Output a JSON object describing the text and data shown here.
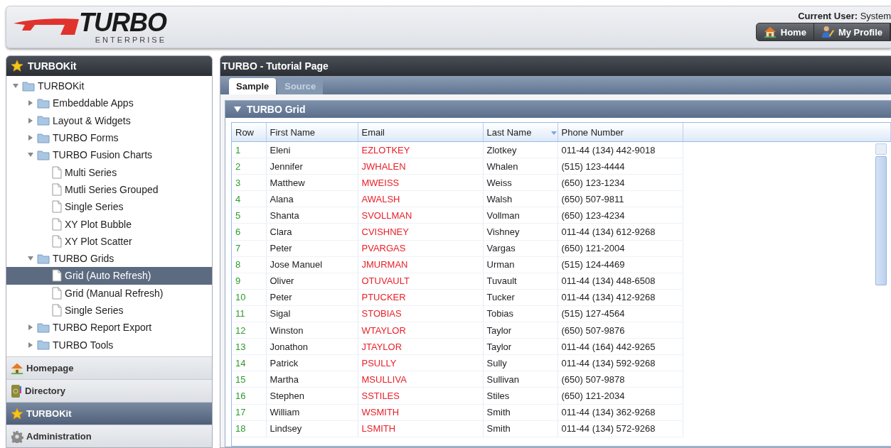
{
  "header": {
    "logo": {
      "title": "TURBO",
      "subtitle": "ENTERPRISE"
    },
    "current_user": "**Current User:** System",
    "buttons": [
      {
        "label": "Home",
        "kind": "home"
      },
      {
        "label": "My Profile",
        "kind": "profile"
      }
    ]
  },
  "sidebar": {
    "title": "TURBOKit",
    "tree": [
      {
        "label": "TURBOKit",
        "kind": "folder",
        "expanded": true,
        "selected": false,
        "children": [
          {
            "label": "Embeddable Apps",
            "kind": "folder",
            "expanded": false,
            "selected": false
          },
          {
            "label": "Layout & Widgets",
            "kind": "folder",
            "expanded": false,
            "selected": false
          },
          {
            "label": "TURBO Forms",
            "kind": "folder",
            "expanded": false,
            "selected": false
          },
          {
            "label": "TURBO Fusion Charts",
            "kind": "folder",
            "expanded": true,
            "selected": false,
            "children": [
              {
                "label": "Multi Series",
                "kind": "page",
                "selected": false
              },
              {
                "label": "Mutli Series Grouped",
                "kind": "page",
                "selected": false
              },
              {
                "label": "Single Series",
                "kind": "page",
                "selected": false
              },
              {
                "label": "XY Plot Bubble",
                "kind": "page",
                "selected": false
              },
              {
                "label": "XY Plot Scatter",
                "kind": "page",
                "selected": false
              }
            ]
          },
          {
            "label": "TURBO Grids",
            "kind": "folder",
            "expanded": true,
            "selected": false,
            "children": [
              {
                "label": "Grid (Auto Refresh)",
                "kind": "page",
                "selected": true
              },
              {
                "label": "Grid (Manual Refresh)",
                "kind": "page",
                "selected": false
              },
              {
                "label": "Single Series",
                "kind": "page",
                "selected": false
              }
            ]
          },
          {
            "label": "TURBO Report Export",
            "kind": "folder",
            "expanded": false,
            "selected": false
          },
          {
            "label": "TURBO Tools",
            "kind": "folder",
            "expanded": false,
            "selected": false
          }
        ]
      }
    ],
    "nav": [
      {
        "label": "Homepage",
        "kind": "home",
        "selected": false
      },
      {
        "label": "Directory",
        "kind": "book",
        "selected": false
      },
      {
        "label": "TURBOKit",
        "kind": "star",
        "selected": true
      },
      {
        "label": "Administration",
        "kind": "gear",
        "selected": false
      }
    ]
  },
  "main": {
    "title": "TURBO - Tutorial Page",
    "tabs": [
      {
        "label": "Sample",
        "selected": true
      },
      {
        "label": "Source",
        "selected": false
      }
    ],
    "grid": {
      "title": "TURBO Grid",
      "expanded": true,
      "columns": [
        {
          "label": "Row",
          "kind": "index",
          "sorted": false
        },
        {
          "label": "First Name",
          "kind": "text",
          "sorted": false
        },
        {
          "label": "Email",
          "kind": "email",
          "sorted": false
        },
        {
          "label": "Last Name",
          "kind": "text",
          "sorted": true
        },
        {
          "label": "Phone Number",
          "kind": "text",
          "sorted": false
        }
      ],
      "rows": [
        [
          "1",
          "Eleni",
          "EZLOTKEY",
          "Zlotkey",
          "011-44 (134) 442-9018"
        ],
        [
          "2",
          "Jennifer",
          "JWHALEN",
          "Whalen",
          "(515) 123-4444"
        ],
        [
          "3",
          "Matthew",
          "MWEISS",
          "Weiss",
          "(650) 123-1234"
        ],
        [
          "4",
          "Alana",
          "AWALSH",
          "Walsh",
          "(650) 507-9811"
        ],
        [
          "5",
          "Shanta",
          "SVOLLMAN",
          "Vollman",
          "(650) 123-4234"
        ],
        [
          "6",
          "Clara",
          "CVISHNEY",
          "Vishney",
          "011-44 (134) 612-9268"
        ],
        [
          "7",
          "Peter",
          "PVARGAS",
          "Vargas",
          "(650) 121-2004"
        ],
        [
          "8",
          "Jose Manuel",
          "JMURMAN",
          "Urman",
          "(515) 124-4469"
        ],
        [
          "9",
          "Oliver",
          "OTUVAULT",
          "Tuvault",
          "011-44 (134) 448-6508"
        ],
        [
          "10",
          "Peter",
          "PTUCKER",
          "Tucker",
          "011-44 (134) 412-9268"
        ],
        [
          "11",
          "Sigal",
          "STOBIAS",
          "Tobias",
          "(515) 127-4564"
        ],
        [
          "12",
          "Winston",
          "WTAYLOR",
          "Taylor",
          "(650) 507-9876"
        ],
        [
          "13",
          "Jonathon",
          "JTAYLOR",
          "Taylor",
          "011-44 (164) 442-9265"
        ],
        [
          "14",
          "Patrick",
          "PSULLY",
          "Sully",
          "011-44 (134) 592-9268"
        ],
        [
          "15",
          "Martha",
          "MSULLIVA",
          "Sullivan",
          "(650) 507-9878"
        ],
        [
          "16",
          "Stephen",
          "SSTILES",
          "Stiles",
          "(650) 121-2034"
        ],
        [
          "17",
          "William",
          "WSMITH",
          "Smith",
          "011-44 (134) 362-9268"
        ],
        [
          "18",
          "Lindsey",
          "LSMITH",
          "Smith",
          "011-44 (134) 572-9268"
        ]
      ]
    }
  }
}
